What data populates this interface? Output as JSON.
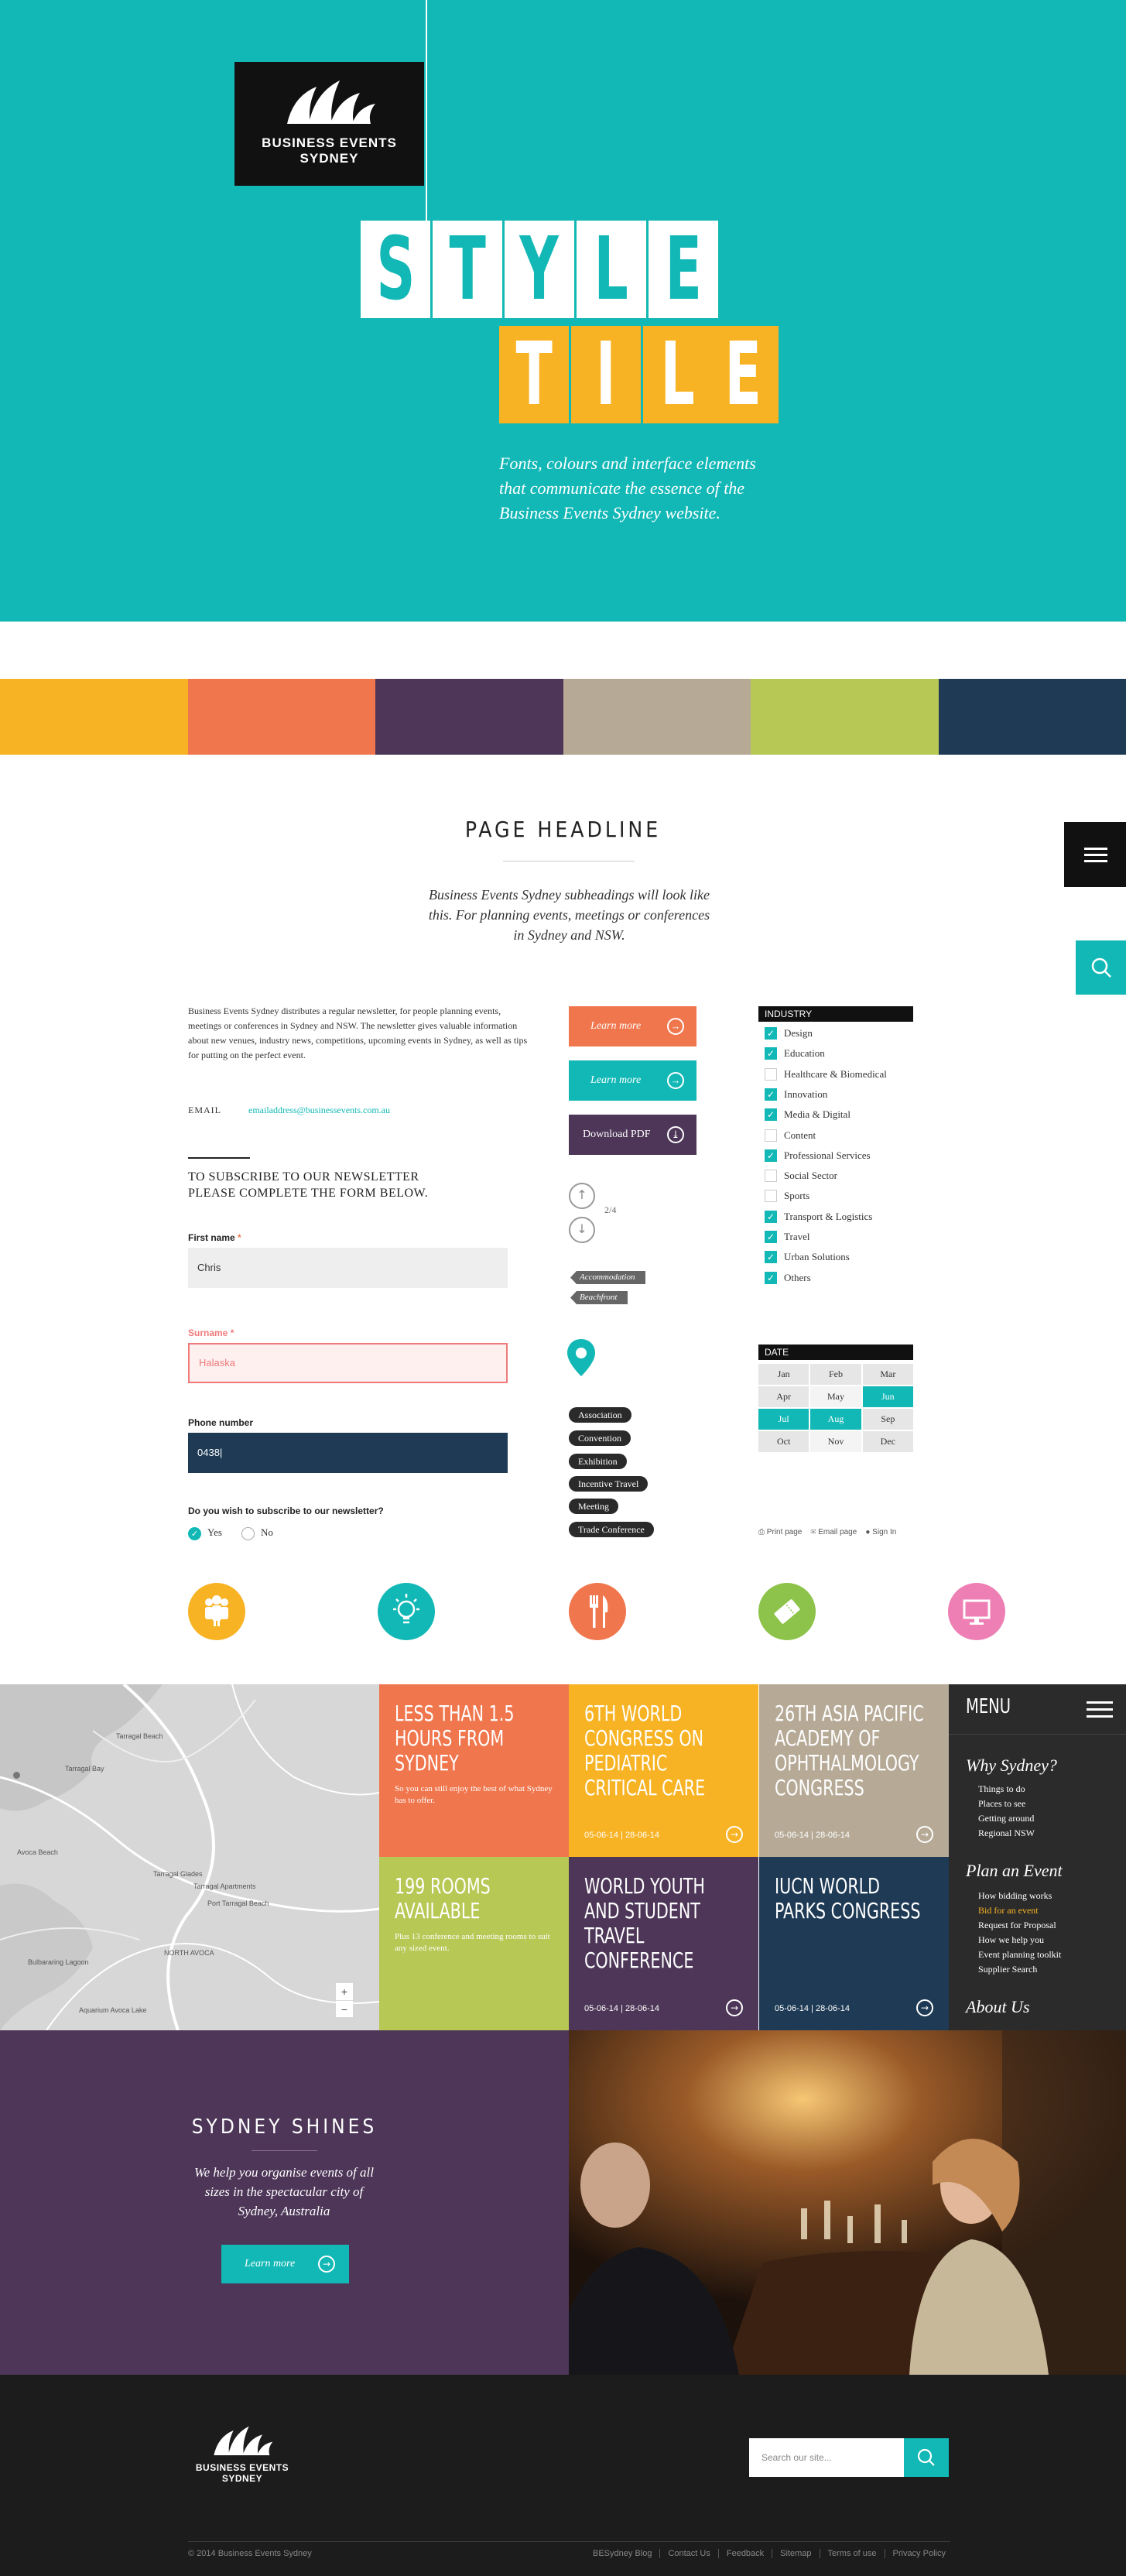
{
  "hero": {
    "logo_line1": "BUSINESS EVENTS",
    "logo_line2": "SYDNEY",
    "title_row1": [
      "S",
      "T",
      "Y",
      "L",
      "E"
    ],
    "title_row2": [
      "T",
      "I",
      "L",
      "E"
    ],
    "tagline": "Fonts, colours and interface elements that communicate the essence of the Business Events Sydney website."
  },
  "palette": [
    "#f7b324",
    "#f0764d",
    "#4d3658",
    "#b6aa97",
    "#b8c855",
    "#1e3a55"
  ],
  "colors": {
    "accent": "#12b8b6",
    "dark": "#1c1c1c"
  },
  "content": {
    "headline": "PAGE HEADLINE",
    "subheading": "Business Events Sydney subheadings will look like this. For planning events, meetings or conferences in Sydney and NSW.",
    "intro": "Business Events Sydney distributes a regular newsletter, for people planning events, meetings or conferences in Sydney and NSW. The newsletter gives valuable information about new venues, industry news, competitions, upcoming events in Sydney, as well as tips for putting on the perfect event.",
    "email_label": "EMAIL",
    "email_value": "emailaddress@businessevents.com.au",
    "subscribe_line1": "TO SUBSCRIBE TO OUR NEWSLETTER",
    "subscribe_line2": "PLEASE COMPLETE THE FORM BELOW.",
    "first_name_label": "First name",
    "first_name_value": "Chris",
    "surname_label": "Surname",
    "surname_value": "Halaska",
    "phone_label": "Phone number",
    "phone_value": "0438|",
    "newsletter_question": "Do you wish to subscribe to our newsletter?",
    "yes": "Yes",
    "no": "No",
    "required_mark": "*"
  },
  "buttons": {
    "learn_more": "Learn more",
    "download_pdf": "Download PDF",
    "pager": "2/4"
  },
  "tags": [
    "Accommodation",
    "Beachfront"
  ],
  "pills": [
    "Association",
    "Convention",
    "Exhibition",
    "Incentive Travel",
    "Meeting",
    "Trade Conference"
  ],
  "industry": {
    "heading": "INDUSTRY",
    "items": [
      {
        "label": "Design",
        "checked": true
      },
      {
        "label": "Education",
        "checked": true
      },
      {
        "label": "Healthcare & Biomedical",
        "checked": false
      },
      {
        "label": "Innovation",
        "checked": true
      },
      {
        "label": "Media & Digital",
        "checked": true
      },
      {
        "label": "Content",
        "checked": false
      },
      {
        "label": "Professional Services",
        "checked": true
      },
      {
        "label": "Social Sector",
        "checked": false
      },
      {
        "label": "Sports",
        "checked": false
      },
      {
        "label": "Transport & Logistics",
        "checked": true
      },
      {
        "label": "Travel",
        "checked": true
      },
      {
        "label": "Urban Solutions",
        "checked": true
      },
      {
        "label": "Others",
        "checked": true
      }
    ]
  },
  "date": {
    "heading": "DATE",
    "months": [
      "Jan",
      "Feb",
      "Mar",
      "Apr",
      "May",
      "Jun",
      "Jul",
      "Aug",
      "Sep",
      "Oct",
      "Nov",
      "Dec"
    ],
    "selected": [
      "Jun",
      "Jul",
      "Aug"
    ]
  },
  "utility": {
    "print": "Print page",
    "email": "Email page",
    "signin": "Sign In"
  },
  "icons": [
    {
      "name": "people-icon",
      "color": "#f7b324"
    },
    {
      "name": "lightbulb-icon",
      "color": "#12b8b6"
    },
    {
      "name": "cutlery-icon",
      "color": "#f0764d"
    },
    {
      "name": "ticket-icon",
      "color": "#8dc34a"
    },
    {
      "name": "screen-icon",
      "color": "#ee7fb4"
    }
  ],
  "map": {
    "labels": [
      "Tarragal Bay",
      "Tarragal Beach",
      "Tarragal Glades",
      "Tarragal Apartments",
      "Port Tarragal Beach",
      "NORTH AVOCA",
      "Avoca Beach",
      "Bulbararing Lagoon",
      "Aquarium Avoca Lake"
    ],
    "zoom_in": "+",
    "zoom_out": "−"
  },
  "promos": [
    {
      "title": "LESS THAN 1.5 HOURS FROM SYDNEY",
      "text": "So you can still enjoy the best of what Sydney has to offer.",
      "color": "#f0764d"
    },
    {
      "title": "6TH WORLD CONGRESS ON PEDIATRIC CRITICAL CARE",
      "dates": "05-06-14  |  28-06-14",
      "color": "#f7b324"
    },
    {
      "title": "26TH ASIA PACIFIC ACADEMY OF OPHTHALMOLOGY CONGRESS",
      "dates": "05-06-14  |  28-06-14",
      "color": "#b6aa97"
    },
    {
      "title": "199 ROOMS AVAILABLE",
      "text": "Plus 13 conference and meeting rooms to suit any sized event.",
      "color": "#b8c855"
    },
    {
      "title": "WORLD YOUTH AND STUDENT TRAVEL CONFERENCE",
      "dates": "05-06-14  |  28-06-14",
      "color": "#4d3658"
    },
    {
      "title": "IUCN WORLD PARKS CONGRESS",
      "dates": "05-06-14  |  28-06-14",
      "color": "#1e3a55"
    }
  ],
  "menu": {
    "title": "MENU",
    "sections": [
      {
        "heading": "Why Sydney?",
        "items": [
          "Things to do",
          "Places to see",
          "Getting around",
          "Regional NSW"
        ]
      },
      {
        "heading": "Plan an Event",
        "items": [
          "How bidding works",
          "Bid for an event",
          "Request for Proposal",
          "How we help you",
          "Event planning toolkit",
          "Supplier Search"
        ]
      },
      {
        "heading": "About Us",
        "items": []
      }
    ],
    "highlight": "Bid for an event"
  },
  "shines": {
    "title": "SYDNEY SHINES",
    "text": "We help you organise events of all sizes in the spectacular city of Sydney, Australia",
    "button": "Learn more"
  },
  "footer": {
    "logo_line1": "BUSINESS EVENTS",
    "logo_line2": "SYDNEY",
    "search_placeholder": "Search our site...",
    "copyright": "© 2014 Business Events Sydney",
    "links": [
      "BESydney Blog",
      "Contact Us",
      "Feedback",
      "Sitemap",
      "Terms of use",
      "Privacy Policy"
    ]
  }
}
